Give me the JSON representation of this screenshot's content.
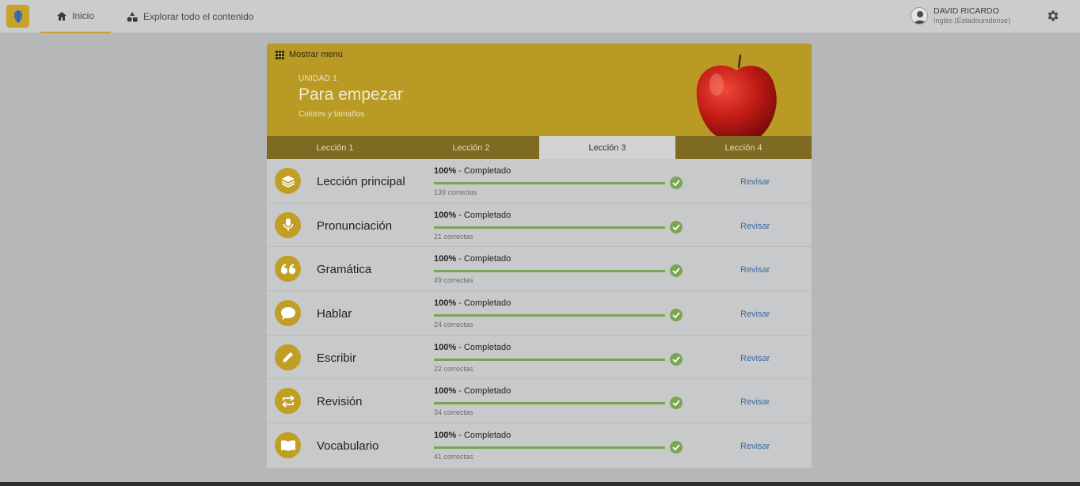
{
  "nav": {
    "home_label": "Inicio",
    "explore_label": "Explorar todo el contenido"
  },
  "user": {
    "name": "DAVID RICARDO",
    "language": "Inglés (Estadounidense)"
  },
  "hero": {
    "menu_label": "Mostrar menú",
    "unit_label": "UNIDAD 1",
    "title": "Para empezar",
    "subtitle": "Colores y tamaños"
  },
  "tabs": [
    {
      "label": "Lección 1",
      "active": false
    },
    {
      "label": "Lección 2",
      "active": false
    },
    {
      "label": "Lección 3",
      "active": true
    },
    {
      "label": "Lección 4",
      "active": false
    }
  ],
  "rows": [
    {
      "icon": "layers-icon",
      "title": "Lección principal",
      "percent": "100%",
      "status": " - Completado",
      "progress": 1.0,
      "correct": "139 correctas",
      "action": "Revisar"
    },
    {
      "icon": "microphone-icon",
      "title": "Pronunciación",
      "percent": "100%",
      "status": " - Completado",
      "progress": 1.0,
      "correct": "21 correctas",
      "action": "Revisar"
    },
    {
      "icon": "quote-icon",
      "title": "Gramática",
      "percent": "100%",
      "status": " - Completado",
      "progress": 1.0,
      "correct": "49 correctas",
      "action": "Revisar"
    },
    {
      "icon": "speech-bubble-icon",
      "title": "Hablar",
      "percent": "100%",
      "status": " - Completado",
      "progress": 1.0,
      "correct": "24 correctas",
      "action": "Revisar"
    },
    {
      "icon": "pencil-icon",
      "title": "Escribir",
      "percent": "100%",
      "status": " - Completado",
      "progress": 1.0,
      "correct": "22 correctas",
      "action": "Revisar"
    },
    {
      "icon": "repeat-icon",
      "title": "Revisión",
      "percent": "100%",
      "status": " - Completado",
      "progress": 1.0,
      "correct": "34 correctas",
      "action": "Revisar"
    },
    {
      "icon": "book-icon",
      "title": "Vocabulario",
      "percent": "100%",
      "status": " - Completado",
      "progress": 1.0,
      "correct": "41 correctas",
      "action": "Revisar"
    }
  ],
  "colors": {
    "accent": "#c19f25",
    "progress": "#7aa552",
    "link": "#3a6aa6"
  }
}
